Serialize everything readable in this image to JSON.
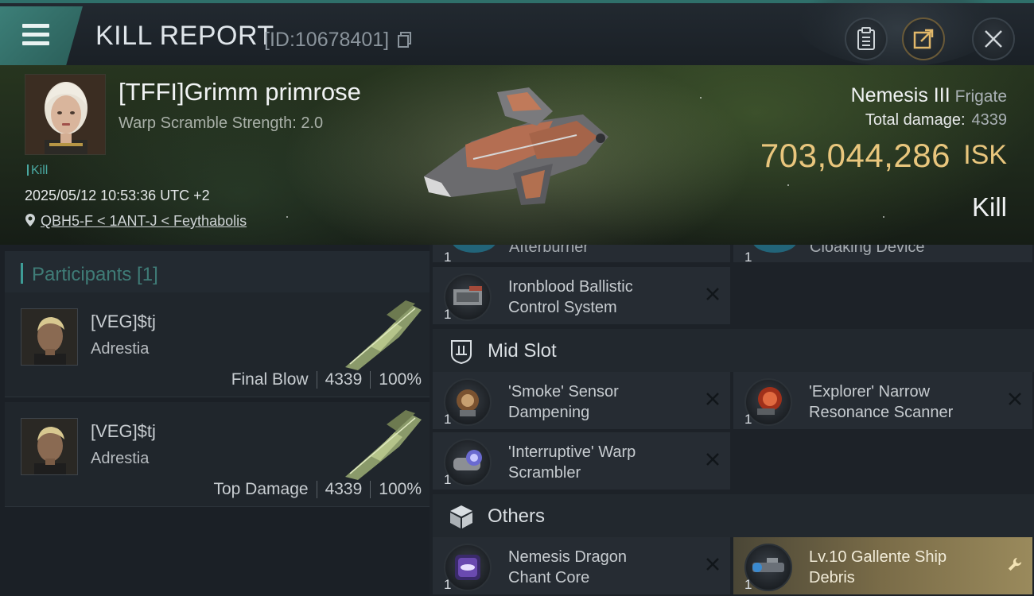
{
  "header": {
    "title": "KILL REPORT",
    "kill_id": "[ID:10678401]"
  },
  "victim": {
    "name": "[TFFI]Grimm primrose",
    "warp_scramble": "Warp Scramble Strength: 2.0",
    "tag": "Kill",
    "datetime": "2025/05/12 10:53:36 UTC +2",
    "location": "QBH5-F < 1ANT-J < Feythabolis",
    "ship": "Nemesis III",
    "ship_class": "Frigate",
    "total_damage_label": "Total damage:",
    "total_damage": "4339",
    "isk_value": "703,044,286",
    "isk_unit": "ISK",
    "result": "Kill"
  },
  "participants": {
    "header": "Participants [1]",
    "rows": [
      {
        "name": "[VEG]$tj",
        "ship": "Adrestia",
        "role": "Final Blow",
        "damage": "4339",
        "percent": "100%"
      },
      {
        "name": "[VEG]$tj",
        "ship": "Adrestia",
        "role": "Top Damage",
        "damage": "4339",
        "percent": "100%"
      }
    ]
  },
  "modules": {
    "partial_top": [
      {
        "name": "Afterburner",
        "qty": "1"
      },
      {
        "name": "Cloaking Device",
        "qty": "1"
      }
    ],
    "low": [
      {
        "name_line1": "Ironblood Ballistic",
        "name_line2": "Control System",
        "qty": "1"
      }
    ],
    "mid_label": "Mid Slot",
    "mid": [
      {
        "name_line1": "'Smoke' Sensor",
        "name_line2": "Dampening",
        "qty": "1"
      },
      {
        "name_line1": "'Explorer' Narrow",
        "name_line2": "Resonance Scanner",
        "qty": "1"
      },
      {
        "name_line1": "'Interruptive' Warp",
        "name_line2": "Scrambler",
        "qty": "1"
      }
    ],
    "others_label": "Others",
    "others": [
      {
        "name_line1": "Nemesis Dragon",
        "name_line2": "Chant Core",
        "qty": "1"
      },
      {
        "name_line1": "Lv.10 Gallente Ship",
        "name_line2": "Debris",
        "qty": "1"
      }
    ]
  },
  "colors": {
    "accent_teal": "#3e9c96",
    "isk_gold": "#e9c67d",
    "highlight_gold": "#9a8a5c"
  }
}
